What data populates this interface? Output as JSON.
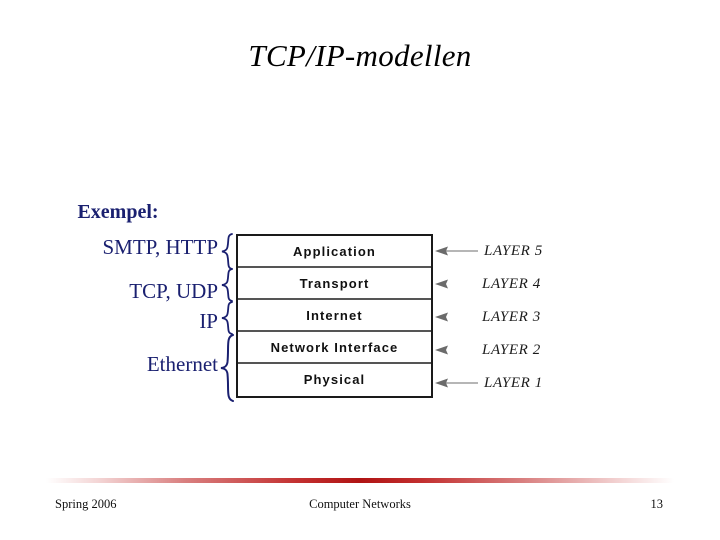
{
  "slide": {
    "title": "TCP/IP-modellen",
    "accent_color": "#1a2070",
    "rule_color": "#b01313"
  },
  "examples": {
    "heading": "Exempel:",
    "items": [
      {
        "label": "SMTP, HTTP"
      },
      {
        "label": "TCP, UDP"
      },
      {
        "label": "IP"
      },
      {
        "label": "Ethernet"
      }
    ]
  },
  "stack": {
    "layers": [
      {
        "name": "Application"
      },
      {
        "name": "Transport"
      },
      {
        "name": "Internet"
      },
      {
        "name": "Network Interface"
      },
      {
        "name": "Physical"
      }
    ]
  },
  "callouts": [
    {
      "label": "LAYER 5"
    },
    {
      "label": "LAYER 4"
    },
    {
      "label": "LAYER 3"
    },
    {
      "label": "LAYER 2"
    },
    {
      "label": "LAYER 1"
    }
  ],
  "footer": {
    "left": "Spring 2006",
    "center": "Computer Networks",
    "right": "13"
  }
}
